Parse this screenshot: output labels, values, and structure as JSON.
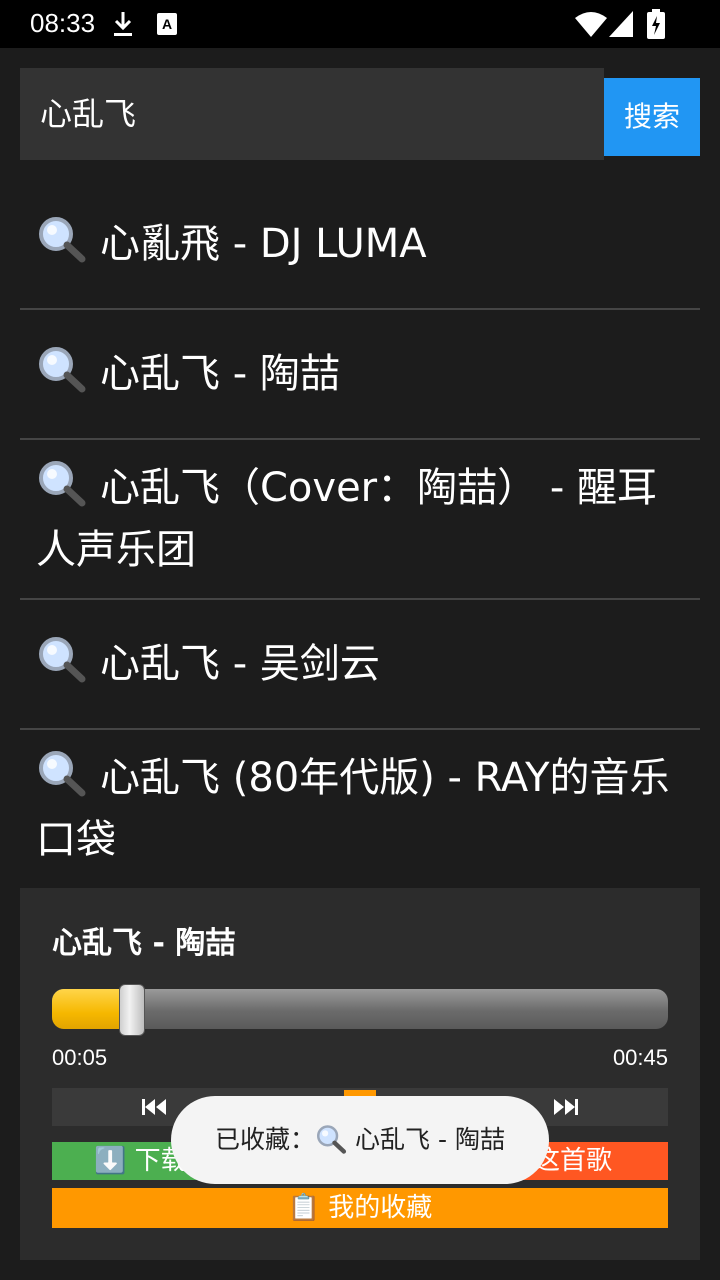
{
  "status_bar": {
    "time": "08:33",
    "icons": [
      "download-icon",
      "keyboard-a-icon",
      "wifi-icon",
      "signal-icon",
      "battery-charging-icon"
    ]
  },
  "search": {
    "value": "心乱飞",
    "button_label": "搜索"
  },
  "results": [
    {
      "icon": "magnifier-icon",
      "title": "心亂飛 - DJ LUMA"
    },
    {
      "icon": "magnifier-icon",
      "title": "心乱飞 - 陶喆"
    },
    {
      "icon": "magnifier-icon",
      "title": "心乱飞（Cover：陶喆） - 醒耳人声乐团"
    },
    {
      "icon": "magnifier-icon",
      "title": "心乱飞 - 吴剑云"
    },
    {
      "icon": "magnifier-icon",
      "title": "心乱飞 (80年代版) - RAY的音乐口袋"
    }
  ],
  "player": {
    "now_playing": "心乱飞 - 陶喆",
    "progress": 0.13,
    "current_time": "00:05",
    "total_time": "00:45",
    "controls": [
      "previous-icon",
      "play-pause-icon",
      "next-icon"
    ],
    "download_label": "⬇️ 下载",
    "favorite_label": "这首歌",
    "collection_label": "📋 我的收藏"
  },
  "toast": {
    "prefix": "已收藏：",
    "song": "心乱飞 - 陶喆"
  },
  "colors": {
    "background": "#1c1c1c",
    "search_button": "#2196f3",
    "download": "#4caf50",
    "favorite": "#ff5722",
    "collection": "#ff9800",
    "progress": "#f6b800"
  }
}
